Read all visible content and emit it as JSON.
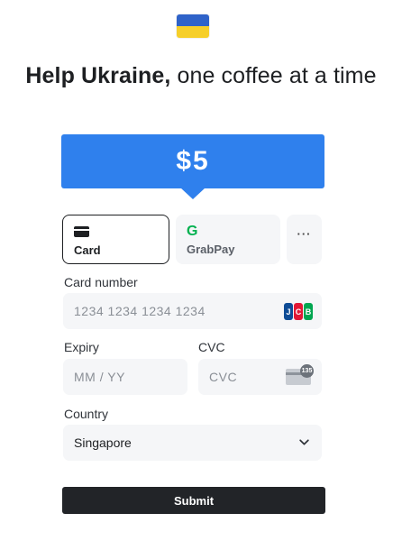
{
  "colors": {
    "accent": "#2f80ed",
    "flag_top": "#2f63c9",
    "flag_bottom": "#f6cf2a",
    "button": "#222428",
    "field_bg": "#f5f6f8",
    "grab_green": "#00b14f"
  },
  "header": {
    "flag_icon": "ukraine-flag",
    "title_bold": "Help Ukraine,",
    "title_rest": " one coffee at a time"
  },
  "amount": {
    "label": "$5"
  },
  "payment_methods": [
    {
      "label": "Card",
      "icon": "credit-card-icon",
      "selected": true
    },
    {
      "label": "GrabPay",
      "icon": "grabpay-icon",
      "selected": false
    },
    {
      "label": "···",
      "icon": "more-icon",
      "selected": false
    }
  ],
  "form": {
    "card_number": {
      "label": "Card number",
      "placeholder": "1234 1234 1234 1234",
      "brand_icon": "jcb-icon"
    },
    "expiry": {
      "label": "Expiry",
      "placeholder": "MM / YY"
    },
    "cvc": {
      "label": "CVC",
      "placeholder": "CVC",
      "badge": "135"
    },
    "country": {
      "label": "Country",
      "value": "Singapore"
    }
  },
  "submit": {
    "label": "Submit"
  }
}
